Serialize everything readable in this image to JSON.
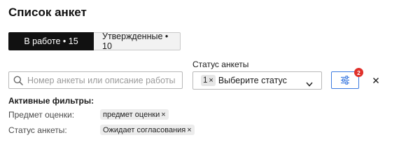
{
  "page": {
    "title": "Список анкет"
  },
  "tabs": [
    {
      "label": "В работе • 15",
      "active": true
    },
    {
      "label": "Утвержденные • 10",
      "active": false
    }
  ],
  "search": {
    "placeholder": "Номер анкеты или описание работы",
    "value": "",
    "icon": "search-icon"
  },
  "status_filter": {
    "label": "Статус анкеты",
    "selected_count": "1",
    "remove_glyph": "×",
    "placeholder": "Выберите статус",
    "icon": "chevron-down-icon"
  },
  "filter_button": {
    "icon": "sliders-icon",
    "badge_count": "2",
    "accent": "#3d7be0",
    "badge_color": "#e0302a"
  },
  "clear_button": {
    "icon": "close-icon"
  },
  "active_filters": {
    "heading": "Активные фильтры:",
    "items": [
      {
        "label": "Предмет оценки:",
        "chip": "предмет оценки",
        "remove": "×"
      },
      {
        "label": "Статус анкеты:",
        "chip": "Ожидает согласования",
        "remove": "×"
      }
    ]
  }
}
